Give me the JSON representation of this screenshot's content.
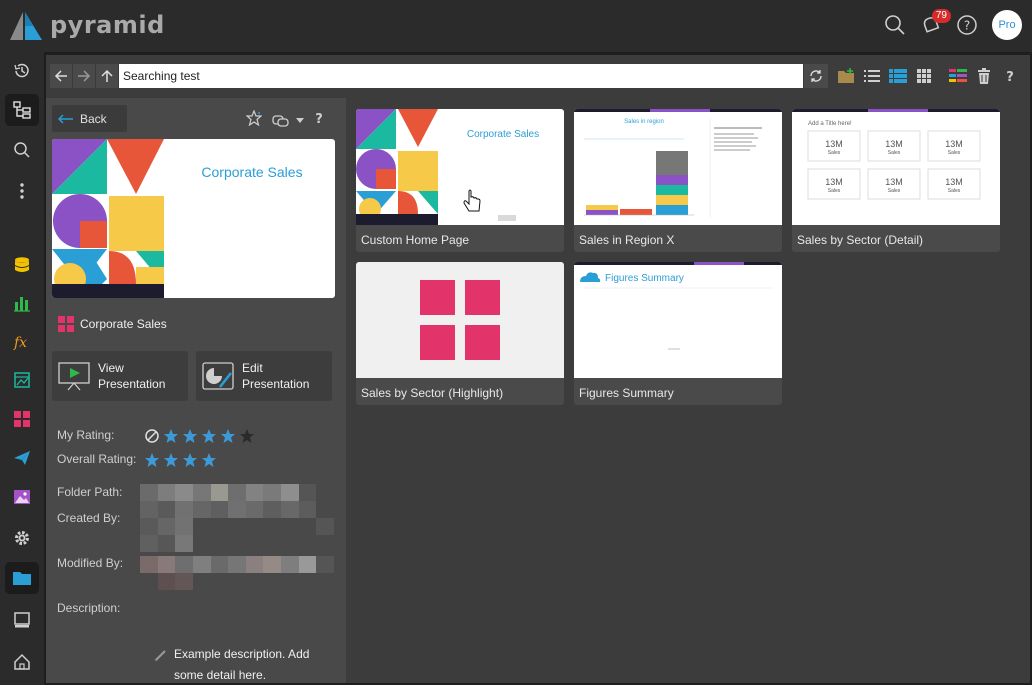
{
  "app": {
    "name": "pyramid",
    "notification_count": "79",
    "avatar_label": "Pro"
  },
  "toolbar": {
    "search_value": "Searching test"
  },
  "panel": {
    "back_label": "Back",
    "thumbnail_title": "Corporate Sales",
    "item_title": "Corporate Sales",
    "view_label_1": "View",
    "view_label_2": "Presentation",
    "edit_label_1": "Edit",
    "edit_label_2": "Presentation",
    "my_rating_label": "My Rating:",
    "overall_rating_label": "Overall Rating:",
    "my_rating": 4,
    "overall_rating": 4,
    "folder_path_label": "Folder Path:",
    "created_by_label": "Created By:",
    "modified_by_label": "Modified By:",
    "description_label": "Description:",
    "description": "Example description. Add some detail here."
  },
  "grid": {
    "items": [
      {
        "label": "Custom Home Page",
        "thumb_title": "Corporate Sales"
      },
      {
        "label": "Sales in Region X",
        "thumb_title": "Sales in region"
      },
      {
        "label": "Sales by Sector (Detail)",
        "thumb_title": "Add a Title here!",
        "kpi": "13M",
        "kpi_label": "Sales"
      },
      {
        "label": "Sales by Sector (Highlight)"
      },
      {
        "label": "Figures Summary",
        "thumb_title": "Figures Summary"
      }
    ]
  },
  "colors": {
    "accent": "#2a9fd6",
    "pink": "#e3336b",
    "purple": "#8a52c4",
    "yellow": "#f7c948",
    "teal": "#1bb9a0",
    "red": "#e8563a"
  }
}
